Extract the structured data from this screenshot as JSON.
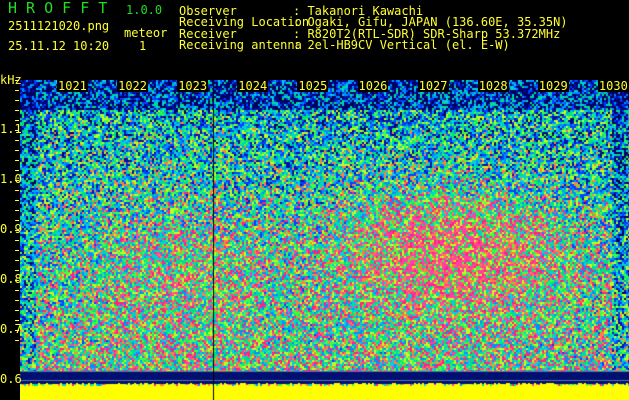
{
  "app": {
    "title": "H R O F F T",
    "version": "1.0.0"
  },
  "file": {
    "name": "2511121020.png",
    "datetime": "25.11.12 10:20"
  },
  "meteor": {
    "label": "meteor",
    "count": "1"
  },
  "info": [
    {
      "label": "Observer",
      "value": ": Takanori Kawachi"
    },
    {
      "label": "Receiving Location",
      "value": ": Ogaki, Gifu, JAPAN (136.60E, 35.35N)"
    },
    {
      "label": "Receiver",
      "value": ": R820T2(RTL-SDR) SDR-Sharp 53.372MHz"
    },
    {
      "label": "Receiving antenna",
      "value": ": 2el-HB9CV Vertical (el. E-W)"
    }
  ],
  "axis": {
    "unit": "kHz",
    "x_ticks": [
      "1021",
      "1022",
      "1023",
      "1024",
      "1025",
      "1026",
      "1027",
      "1028",
      "1029",
      "1030"
    ],
    "y_ticks": [
      "1.1",
      "1.0",
      "0.9",
      "0.8",
      "0.7",
      "0.6"
    ]
  },
  "colors": {
    "text": "#ffff33",
    "title": "#22dd22",
    "baseline": "#ffff00"
  }
}
